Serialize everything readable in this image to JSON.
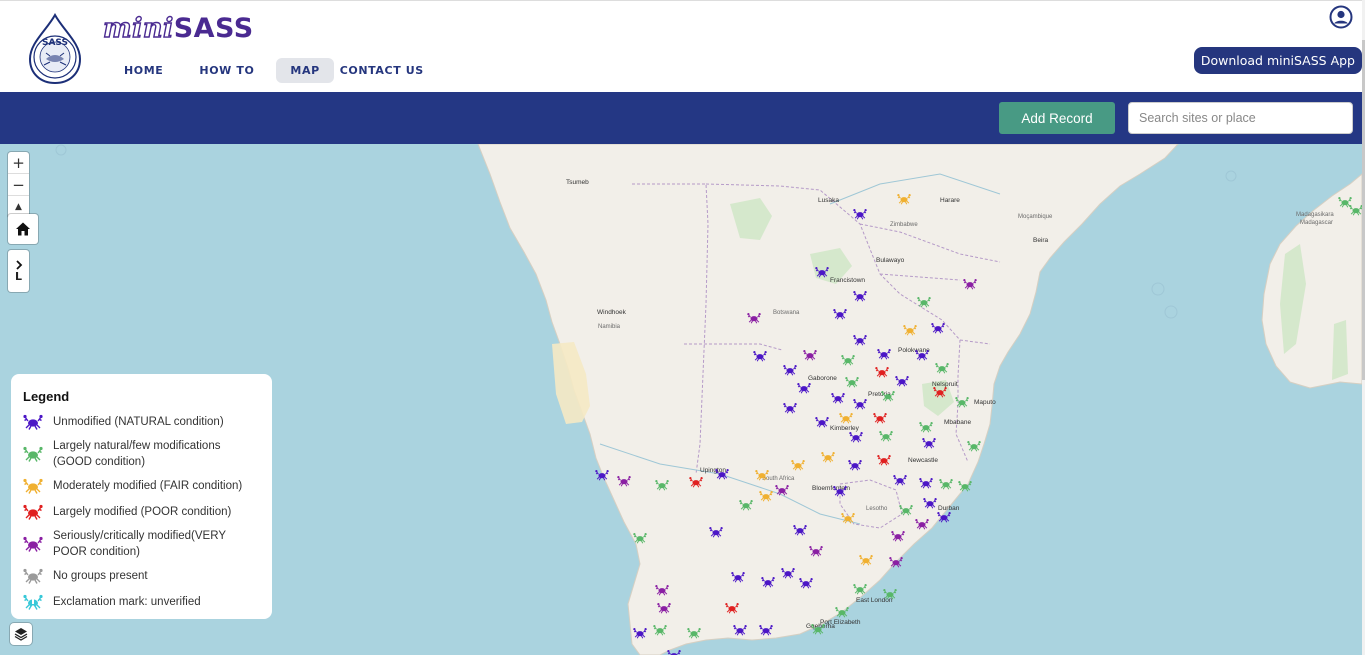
{
  "brand": {
    "mini": "mini",
    "sass": "SASS"
  },
  "nav": {
    "home": "HOME",
    "howto": "HOW TO",
    "map": "MAP",
    "contact": "CONTACT US"
  },
  "download_label": "Download miniSASS App",
  "toolbar": {
    "add_record": "Add Record",
    "search_placeholder": "Search sites or place"
  },
  "map_controls": {
    "zoom_in": "+",
    "zoom_out": "−",
    "reset_north": "▲",
    "legend_toggle": "L"
  },
  "legend": {
    "title": "Legend",
    "items": [
      {
        "label": "Unmodified (NATURAL condition)",
        "color": "#4b16c6"
      },
      {
        "label": "Largely natural/few modifications (GOOD condition)",
        "color": "#58b768"
      },
      {
        "label": "Moderately modified (FAIR condition)",
        "color": "#f0b030"
      },
      {
        "label": "Largely modified (POOR condition)",
        "color": "#e02020"
      },
      {
        "label": "Seriously/critically modified(VERY POOR condition)",
        "color": "#8a1fa3"
      },
      {
        "label": "No groups present",
        "color": "#9a9a9a"
      },
      {
        "label": "Exclamation mark: unverified",
        "color": "#38c8d8"
      }
    ]
  },
  "map_labels": [
    "Windhoek",
    "Namibia",
    "Botswana",
    "Gaborone",
    "Pretoria",
    "Zimbabwe",
    "Harare",
    "Bulawayo",
    "Moçambique",
    "Beira",
    "Francistown",
    "Lesotho",
    "Bloemfontein",
    "Durban",
    "Maputo",
    "Mbabane",
    "Madagasikara",
    "Madagascar",
    "Upington",
    "South Africa",
    "Kimberley",
    "Polokwane",
    "Nelspruit",
    "Newcastle",
    "Port Elizabeth",
    "East London",
    "Gqeberha",
    "Lusaka",
    "Tsumeb"
  ]
}
